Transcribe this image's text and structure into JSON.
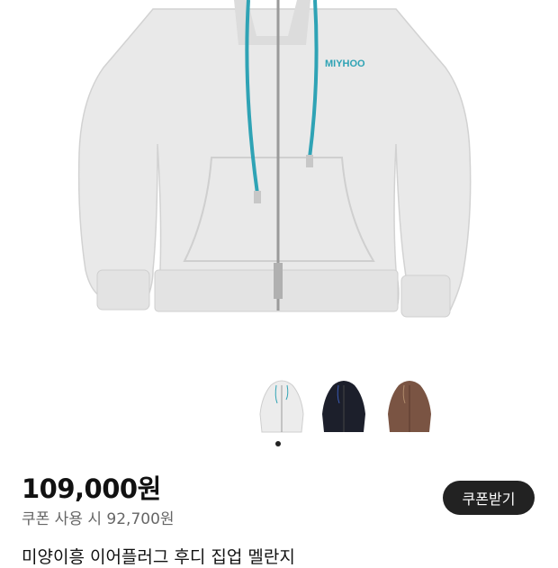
{
  "product": {
    "image_alt": "zip-up hoodie",
    "brand_print": "MIYHOO",
    "title": "미양이흥 이어플러그 후디 집업 멜란지",
    "price": "109,000원",
    "coupon_price_text": "쿠폰 사용 시 92,700원",
    "coupon_button_label": "쿠폰받기"
  },
  "thumbnails": [
    {
      "name": "melange",
      "color": "#ececec",
      "selected": true
    },
    {
      "name": "navy",
      "color": "#1c1f2b",
      "selected": false
    },
    {
      "name": "brown",
      "color": "#7a5443",
      "selected": false
    }
  ],
  "colors": {
    "drawcord": "#2fa3b5",
    "hoodie_main": "#e9e9e9",
    "button_bg": "#222222"
  }
}
